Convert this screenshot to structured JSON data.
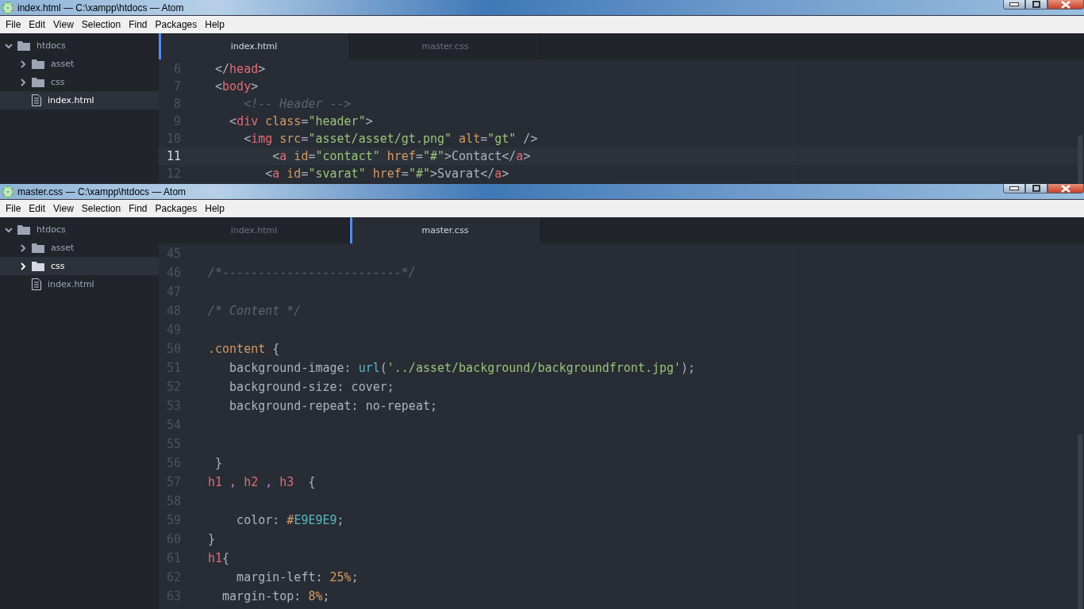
{
  "windows": [
    {
      "title": "index.html — C:\\xampp\\htdocs — Atom",
      "menu": [
        "File",
        "Edit",
        "View",
        "Selection",
        "Find",
        "Packages",
        "Help"
      ],
      "tree": {
        "label": "htdocs",
        "expanded": true,
        "children": [
          {
            "kind": "folder",
            "label": "asset",
            "expanded": false,
            "selected": false
          },
          {
            "kind": "folder",
            "label": "css",
            "expanded": false,
            "selected": false
          },
          {
            "kind": "file",
            "label": "index.html",
            "selected": true
          }
        ]
      },
      "tabs": [
        {
          "label": "index.html",
          "selected": true
        },
        {
          "label": "master.css",
          "selected": false
        }
      ],
      "lines": [
        {
          "number": "6",
          "selected": false,
          "tokens": [
            {
              "kind": "punct",
              "text": " </"
            },
            {
              "kind": "tag",
              "text": "head"
            },
            {
              "kind": "punct",
              "text": ">"
            }
          ]
        },
        {
          "number": "7",
          "selected": false,
          "tokens": [
            {
              "kind": "punct",
              "text": " <"
            },
            {
              "kind": "tag",
              "text": "body"
            },
            {
              "kind": "punct",
              "text": ">"
            }
          ]
        },
        {
          "number": "8",
          "selected": false,
          "tokens": [
            {
              "kind": "comment",
              "text": "     <!-- Header -->"
            }
          ]
        },
        {
          "number": "9",
          "selected": false,
          "tokens": [
            {
              "kind": "punct",
              "text": "   <"
            },
            {
              "kind": "tag",
              "text": "div"
            },
            {
              "kind": "attr",
              "text": " class"
            },
            {
              "kind": "punct",
              "text": "="
            },
            {
              "kind": "string",
              "text": "\"header\""
            },
            {
              "kind": "punct",
              "text": ">"
            }
          ]
        },
        {
          "number": "10",
          "selected": false,
          "tokens": [
            {
              "kind": "punct",
              "text": "     <"
            },
            {
              "kind": "tag",
              "text": "img"
            },
            {
              "kind": "attr",
              "text": " src"
            },
            {
              "kind": "punct",
              "text": "="
            },
            {
              "kind": "string",
              "text": "\"asset/asset/gt.png\""
            },
            {
              "kind": "attr",
              "text": " alt"
            },
            {
              "kind": "punct",
              "text": "="
            },
            {
              "kind": "string",
              "text": "\"gt\""
            },
            {
              "kind": "punct",
              "text": " />"
            }
          ]
        },
        {
          "number": "11",
          "selected": true,
          "tokens": [
            {
              "kind": "punct",
              "text": "         <"
            },
            {
              "kind": "tag",
              "text": "a"
            },
            {
              "kind": "attr",
              "text": " id"
            },
            {
              "kind": "punct",
              "text": "="
            },
            {
              "kind": "string",
              "text": "\"contact\""
            },
            {
              "kind": "attr",
              "text": " href"
            },
            {
              "kind": "punct",
              "text": "="
            },
            {
              "kind": "string",
              "text": "\"#\""
            },
            {
              "kind": "punct",
              "text": ">Contact</"
            },
            {
              "kind": "tag",
              "text": "a"
            },
            {
              "kind": "punct",
              "text": ">"
            }
          ]
        },
        {
          "number": "12",
          "selected": false,
          "tokens": [
            {
              "kind": "punct",
              "text": "        <"
            },
            {
              "kind": "tag",
              "text": "a"
            },
            {
              "kind": "attr",
              "text": " id"
            },
            {
              "kind": "punct",
              "text": "="
            },
            {
              "kind": "string",
              "text": "\"svarat\""
            },
            {
              "kind": "attr",
              "text": " href"
            },
            {
              "kind": "punct",
              "text": "="
            },
            {
              "kind": "string",
              "text": "\"#\""
            },
            {
              "kind": "punct",
              "text": ">Svarat</"
            },
            {
              "kind": "tag",
              "text": "a"
            },
            {
              "kind": "punct",
              "text": ">"
            }
          ]
        }
      ]
    },
    {
      "title": "master.css — C:\\xampp\\htdocs — Atom",
      "menu": [
        "File",
        "Edit",
        "View",
        "Selection",
        "Find",
        "Packages",
        "Help"
      ],
      "tree": {
        "label": "htdocs",
        "expanded": true,
        "children": [
          {
            "kind": "folder",
            "label": "asset",
            "expanded": false,
            "selected": false
          },
          {
            "kind": "folder",
            "label": "css",
            "expanded": false,
            "selected": true
          },
          {
            "kind": "file",
            "label": "index.html",
            "selected": false
          }
        ]
      },
      "tabs": [
        {
          "label": "index.html",
          "selected": false
        },
        {
          "label": "master.css",
          "selected": true
        }
      ],
      "lines": [
        {
          "number": "45",
          "selected": false
        },
        {
          "number": "46",
          "selected": false,
          "tokens": [
            {
              "kind": "comment",
              "text": "/*-------------------------*/"
            }
          ]
        },
        {
          "number": "47",
          "selected": false
        },
        {
          "number": "48",
          "selected": false,
          "tokens": [
            {
              "kind": "comment",
              "text": "/* Content */"
            }
          ]
        },
        {
          "number": "49",
          "selected": false
        },
        {
          "number": "50",
          "selected": false,
          "tokens": [
            {
              "kind": "attr",
              "text": ".content"
            },
            {
              "kind": "punct",
              "text": " {"
            }
          ]
        },
        {
          "number": "51",
          "selected": false,
          "tokens": [
            {
              "kind": "punct",
              "text": "   background-image: "
            },
            {
              "kind": "func",
              "text": "url"
            },
            {
              "kind": "punct",
              "text": "("
            },
            {
              "kind": "string",
              "text": "'../asset/background/backgroundfront.jpg'"
            },
            {
              "kind": "punct",
              "text": ");"
            }
          ]
        },
        {
          "number": "52",
          "selected": false,
          "tokens": [
            {
              "kind": "punct",
              "text": "   background-size: cover;"
            }
          ]
        },
        {
          "number": "53",
          "selected": false,
          "tokens": [
            {
              "kind": "punct",
              "text": "   background-repeat: no-repeat;"
            }
          ]
        },
        {
          "number": "54",
          "selected": false
        },
        {
          "number": "55",
          "selected": false
        },
        {
          "number": "56",
          "selected": false,
          "tokens": [
            {
              "kind": "punct",
              "text": " }"
            }
          ]
        },
        {
          "number": "57",
          "selected": false,
          "tokens": [
            {
              "kind": "tag",
              "text": "h1"
            },
            {
              "kind": "comma",
              "text": " , "
            },
            {
              "kind": "tag",
              "text": "h2"
            },
            {
              "kind": "comma",
              "text": " , "
            },
            {
              "kind": "tag",
              "text": "h3"
            },
            {
              "kind": "punct",
              "text": "  {"
            }
          ]
        },
        {
          "number": "58",
          "selected": false
        },
        {
          "number": "59",
          "selected": false,
          "tokens": [
            {
              "kind": "punct",
              "text": "    color: "
            },
            {
              "kind": "attr",
              "text": "#"
            },
            {
              "kind": "func",
              "text": "E9E9E9"
            },
            {
              "kind": "punct",
              "text": ";"
            }
          ]
        },
        {
          "number": "60",
          "selected": false,
          "tokens": [
            {
              "kind": "punct",
              "text": "}"
            }
          ]
        },
        {
          "number": "61",
          "selected": false,
          "tokens": [
            {
              "kind": "tag",
              "text": "h1"
            },
            {
              "kind": "punct",
              "text": "{"
            }
          ]
        },
        {
          "number": "62",
          "selected": false,
          "tokens": [
            {
              "kind": "punct",
              "text": "    margin-left: "
            },
            {
              "kind": "attr",
              "text": "25%"
            },
            {
              "kind": "punct",
              "text": ";"
            }
          ]
        },
        {
          "number": "63",
          "selected": false,
          "tokens": [
            {
              "kind": "punct",
              "text": "  margin-top: "
            },
            {
              "kind": "attr",
              "text": "8%"
            },
            {
              "kind": "punct",
              "text": ";"
            }
          ]
        }
      ]
    }
  ]
}
